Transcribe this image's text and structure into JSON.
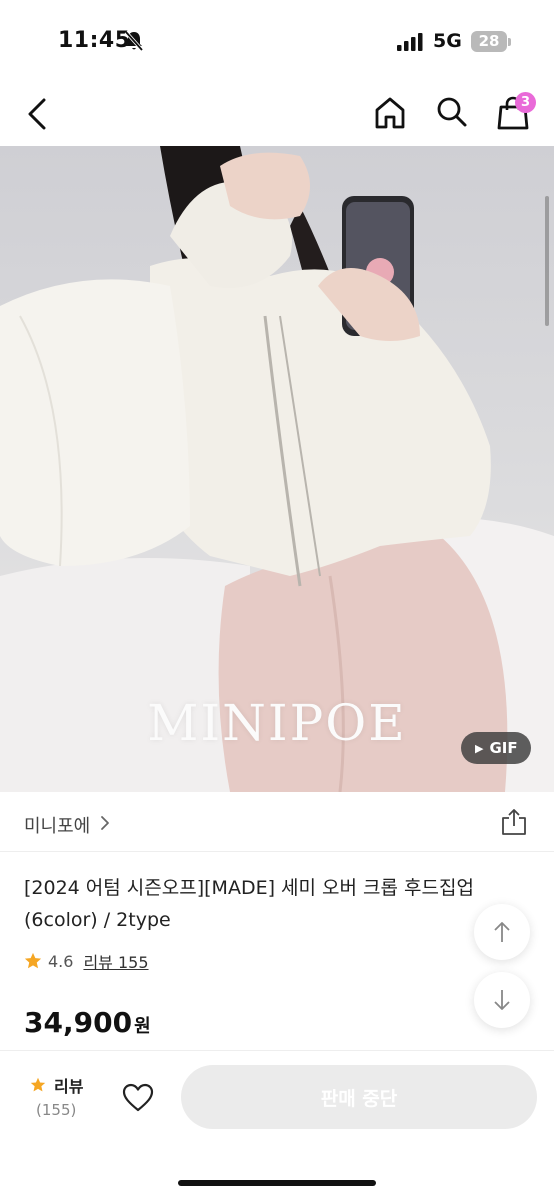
{
  "status_bar": {
    "time": "11:45",
    "network": "5G",
    "battery": "28"
  },
  "nav": {
    "icons": [
      "back-icon",
      "home-icon",
      "search-icon",
      "cart-icon"
    ],
    "cart_badge": "3"
  },
  "hero": {
    "brand_watermark": "MINIPOE",
    "gif_label": "GIF"
  },
  "shop": {
    "name": "미니포에"
  },
  "product": {
    "title": "[2024 어텀 시즌오프][MADE] 세미 오버 크롭 후드집업 (6color) / 2type",
    "rating": "4.6",
    "review_link": "리뷰 155",
    "price": "34,900",
    "currency": "원"
  },
  "bottom_bar": {
    "review_label": "리뷰",
    "review_count": "(155)",
    "buy_button": "판매 중단"
  },
  "colors": {
    "accent_badge": "#e96ad8",
    "star": "#f5a623",
    "disabled_button": "#ebebeb"
  }
}
